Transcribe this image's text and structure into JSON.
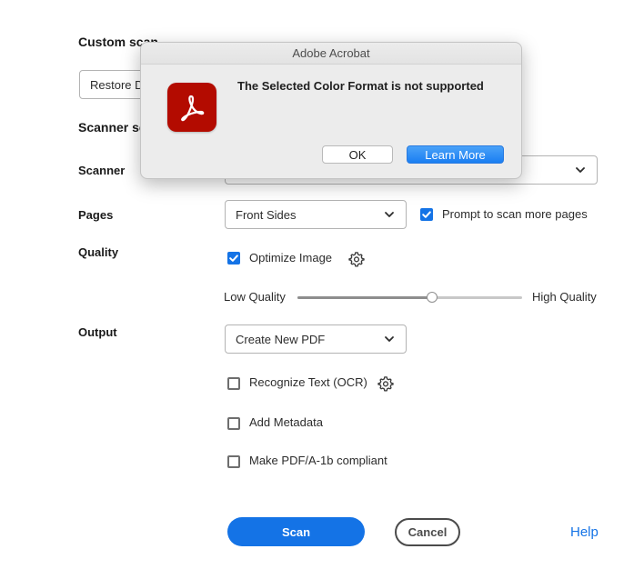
{
  "custom_scan": {
    "title": "Custom scan",
    "restore_button": "Restore Defaults"
  },
  "scanner_settings": {
    "title": "Scanner settings",
    "scanner_label": "Scanner",
    "scanner_value": ""
  },
  "pages": {
    "label": "Pages",
    "value": "Front Sides",
    "prompt_checked": true,
    "prompt_label": "Prompt to scan more pages"
  },
  "quality": {
    "label": "Quality",
    "optimize_checked": true,
    "optimize_label": "Optimize Image",
    "low_label": "Low Quality",
    "high_label": "High Quality",
    "slider_level": 0.6
  },
  "output": {
    "label": "Output",
    "value": "Create New PDF",
    "ocr_checked": false,
    "ocr_label": "Recognize Text (OCR)",
    "metadata_checked": false,
    "metadata_label": "Add Metadata",
    "pdfa_checked": false,
    "pdfa_label": "Make PDF/A-1b compliant"
  },
  "actions": {
    "scan": "Scan",
    "cancel": "Cancel",
    "help": "Help"
  },
  "dialog": {
    "title": "Adobe Acrobat",
    "message": "The Selected Color Format is not supported",
    "ok": "OK",
    "learn_more": "Learn More"
  },
  "colors": {
    "accent": "#1473e6",
    "acrobat_red": "#b30b00"
  }
}
